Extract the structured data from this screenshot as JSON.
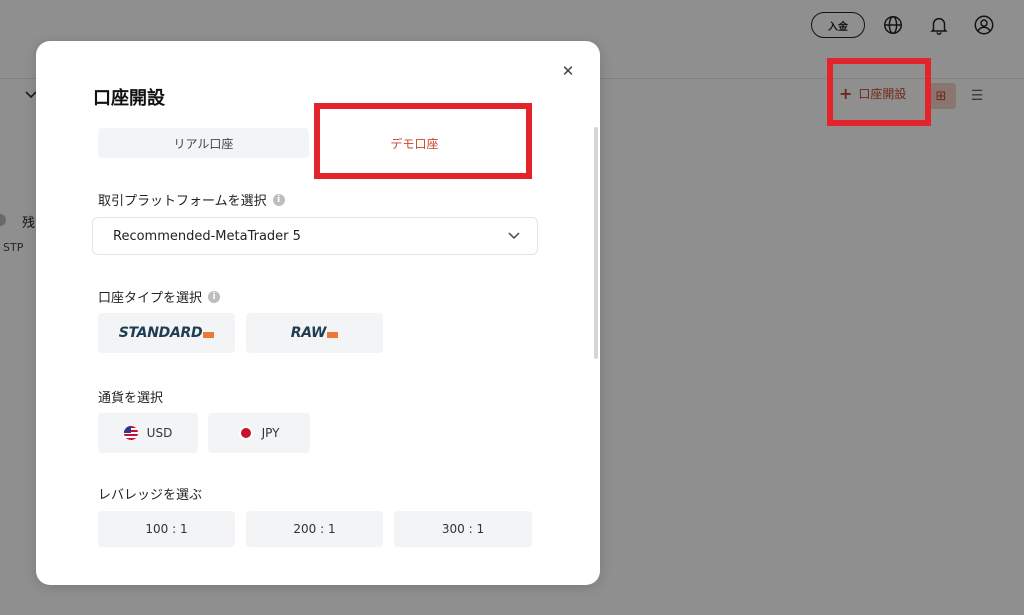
{
  "header": {
    "deposit_label": "入金",
    "icons": [
      "globe-icon",
      "bell-icon",
      "user-icon"
    ]
  },
  "background": {
    "left_text": "残",
    "left_sub": "STP",
    "open_account_label": "口座開設",
    "view_grid_icon": "grid-icon",
    "view_list_icon": "list-icon"
  },
  "modal": {
    "title": "口座開設",
    "close_icon": "close-icon",
    "tabs": {
      "real": "リアル口座",
      "demo": "デモ口座"
    },
    "platform": {
      "label": "取引プラットフォームを選択",
      "selected": "Recommended-MetaTrader 5"
    },
    "account_type": {
      "label": "口座タイプを選択",
      "options": [
        "STANDARD",
        "RAW"
      ]
    },
    "currency": {
      "label": "通貨を選択",
      "options": [
        "USD",
        "JPY"
      ]
    },
    "leverage": {
      "label": "レバレッジを選ぶ",
      "options": [
        "100 : 1",
        "200 : 1",
        "300 : 1"
      ]
    }
  },
  "colors": {
    "accent": "#c8462a",
    "highlight_box": "#e3242b",
    "overlay": "#8f8f8f",
    "logo_text": "#1f3d52",
    "logo_tag": "#e97a3a"
  }
}
